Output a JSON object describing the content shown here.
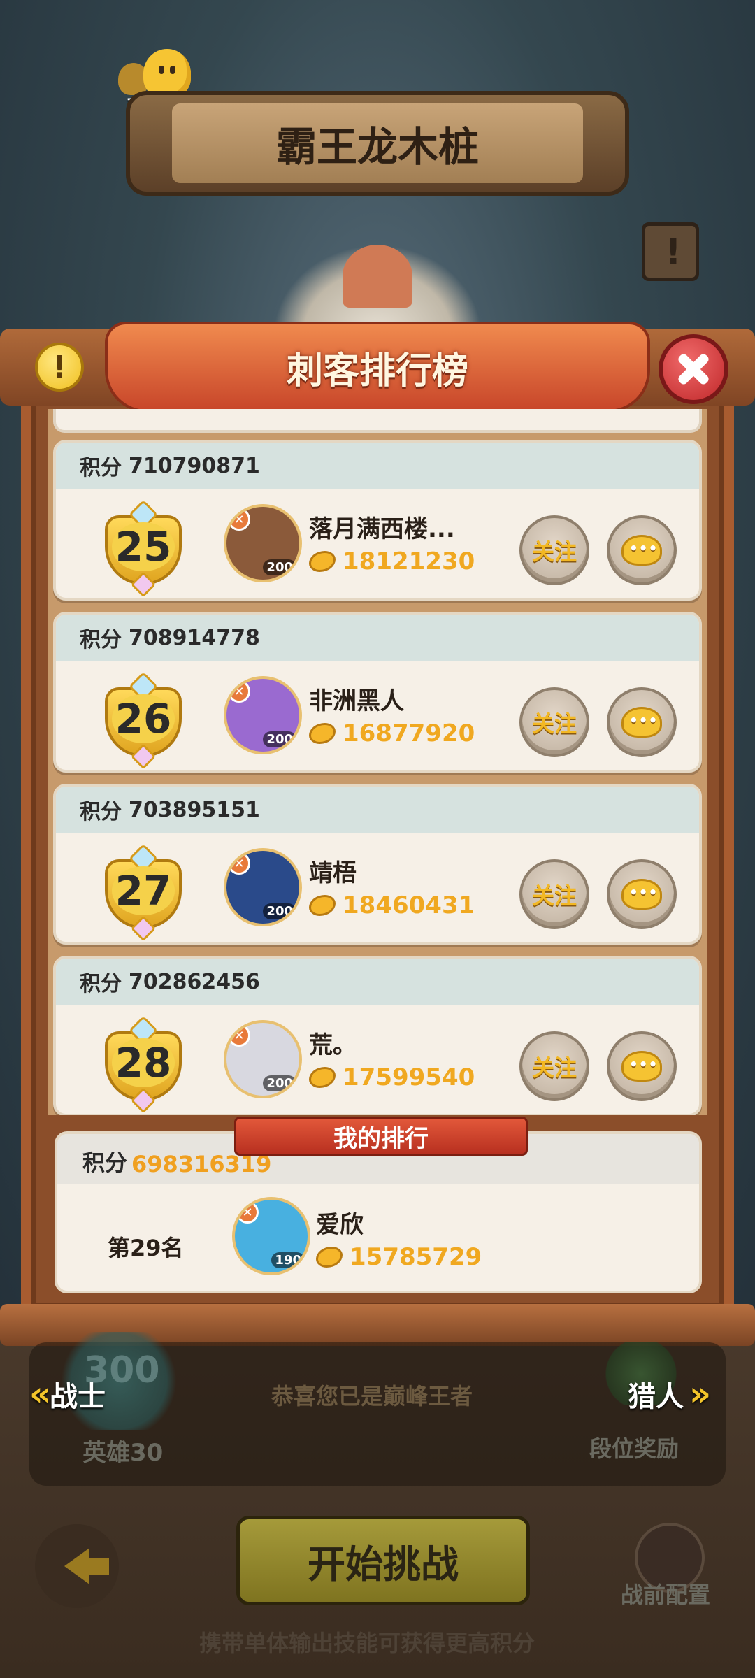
{
  "header": {
    "chat_label": "聊天",
    "stage_title": "霸王龙木桩"
  },
  "board": {
    "title": "刺客排行榜",
    "warning_glyph": "!",
    "score_key": "积分",
    "follow_label": "关注"
  },
  "entries": [
    {
      "rank": "25",
      "score": "710790871",
      "name": "落月满西楼...",
      "power": "18121230",
      "level": "200",
      "avatar_color": "#8b5a3a"
    },
    {
      "rank": "26",
      "score": "708914778",
      "name": "非洲黑人",
      "power": "16877920",
      "level": "200",
      "avatar_color": "#9a6ad0"
    },
    {
      "rank": "27",
      "score": "703895151",
      "name": "靖梧",
      "power": "18460431",
      "level": "200",
      "avatar_color": "#2a4a8a"
    },
    {
      "rank": "28",
      "score": "702862456",
      "name": "荒。",
      "power": "17599540",
      "level": "200",
      "avatar_color": "#d8d8e0"
    }
  ],
  "my_rank": {
    "banner": "我的排行",
    "score_key": "积分",
    "score": "698316319",
    "position": "第29名",
    "name": "爱欣",
    "power": "15785729",
    "level": "190",
    "avatar_color": "#48b0e0"
  },
  "bottom": {
    "badge_number": "300",
    "hero_label": "英雄30",
    "prev_class": "战士",
    "next_class": "猎人",
    "congrats": "恭喜您已是巅峰王者",
    "reward_label": "段位奖励",
    "start_label": "开始挑战",
    "loadout_label": "战前配置",
    "tip": "携带单体输出技能可获得更高积分"
  },
  "colors": {
    "accent_gold": "#f0a820",
    "ribbon_red": "#c8462a",
    "card_bg": "#f6f0e7",
    "card_header": "#d6e2df"
  }
}
